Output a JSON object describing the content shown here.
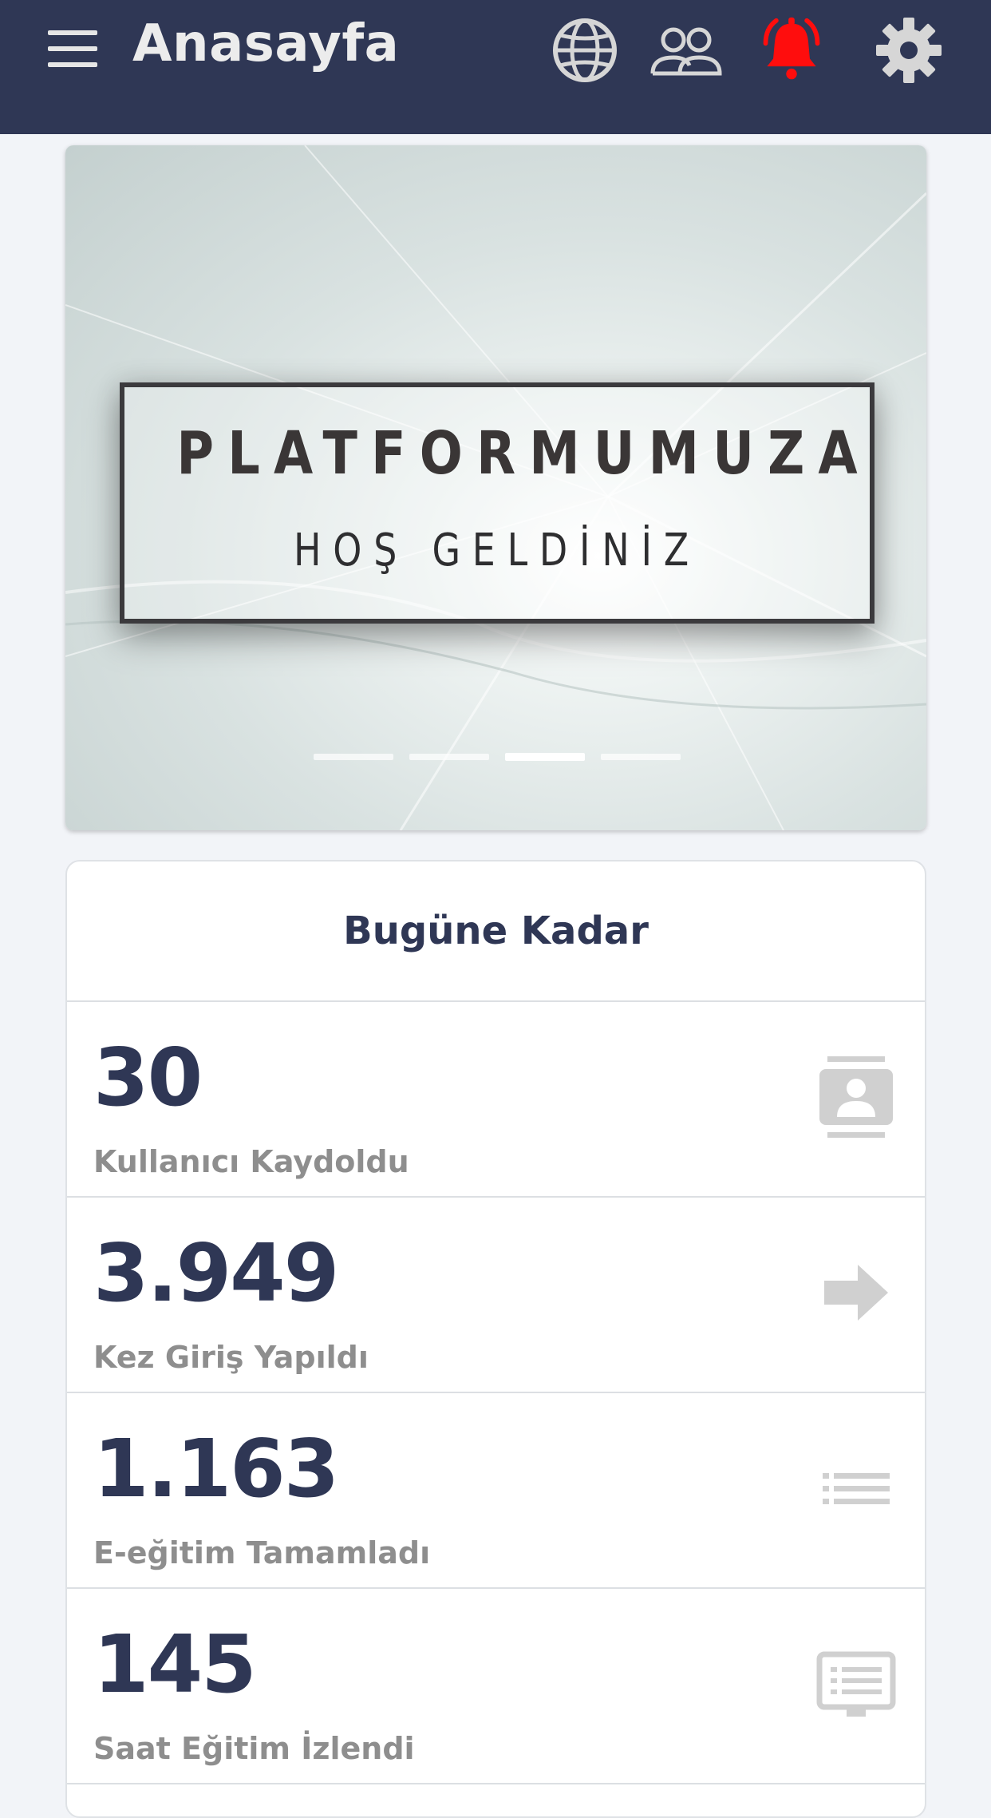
{
  "appbar": {
    "title": "Anasayfa",
    "icons": [
      "menu-icon",
      "globe-icon",
      "users-icon",
      "bell-icon",
      "gear-icon"
    ],
    "colors": {
      "background": "#2f3755",
      "icon": "#d6d6d6",
      "bell_alert": "#ff0d0d"
    }
  },
  "carousel": {
    "banner_line1": "PLATFORMUMUZA",
    "banner_line2": "HOŞ GELDİNİZ",
    "slide_count": 4,
    "active_slide": 3
  },
  "stats": {
    "header": "Bugüne Kadar",
    "rows": [
      {
        "value": "30",
        "label": "Kullanıcı Kaydoldu",
        "icon": "contact-card-icon"
      },
      {
        "value": "3.949",
        "label": "Kez Giriş Yapıldı",
        "icon": "arrow-right-icon"
      },
      {
        "value": "1.163",
        "label": "E-eğitim Tamamladı",
        "icon": "list-icon"
      },
      {
        "value": "145",
        "label": "Saat Eğitim İzlendi",
        "icon": "display-list-icon"
      }
    ],
    "colors": {
      "value": "#2f3755",
      "label": "#8e8e8e",
      "icon": "#d0d0d0"
    }
  }
}
